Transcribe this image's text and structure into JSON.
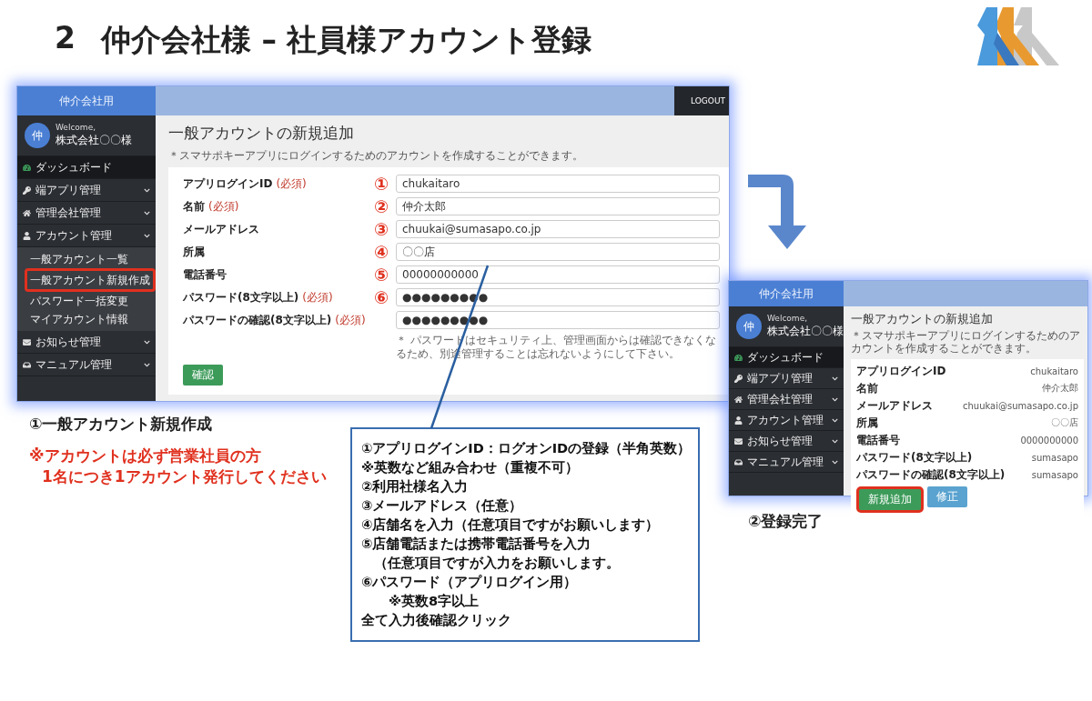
{
  "slide": {
    "number": "2",
    "title": "仲介会社様 – 社員様アカウント登録"
  },
  "screen_entry": {
    "brand": "仲介会社用",
    "logout": "LOGOUT",
    "user": {
      "avatar": "仲",
      "welcome": "Welcome,",
      "name": "株式会社〇〇様"
    },
    "menu": [
      {
        "label": "ダッシュボード",
        "kind": "link",
        "selected": true
      },
      {
        "label": "端アプリ管理",
        "kind": "group",
        "selected": false
      },
      {
        "label": "管理会社管理",
        "kind": "group",
        "selected": false
      },
      {
        "label": "アカウント管理",
        "kind": "group",
        "selected": false,
        "children": [
          {
            "label": "一般アカウント一覧",
            "highlighted": false
          },
          {
            "label": "一般アカウント新規作成",
            "highlighted": true
          },
          {
            "label": "パスワード一括変更",
            "highlighted": false
          },
          {
            "label": "マイアカウント情報",
            "highlighted": false
          }
        ]
      },
      {
        "label": "お知らせ管理",
        "kind": "group",
        "selected": false
      },
      {
        "label": "マニュアル管理",
        "kind": "group",
        "selected": false
      }
    ],
    "page_title": "一般アカウントの新規追加",
    "description": "＊スマサポキーアプリにログインするためのアカウントを作成することができます。",
    "fields": [
      {
        "label": "アプリログインID",
        "required_tag": "(必須)",
        "marker": "①",
        "value": "chukaitaro"
      },
      {
        "label": "名前",
        "required_tag": "(必須)",
        "marker": "②",
        "value": "仲介太郎"
      },
      {
        "label": "メールアドレス",
        "marker": "③",
        "value": "chuukai@sumasapo.co.jp"
      },
      {
        "label": "所属",
        "marker": "④",
        "value": "〇〇店"
      },
      {
        "label": "電話番号",
        "marker": "⑤",
        "value": "00000000000"
      },
      {
        "label": "パスワード(8文字以上)",
        "required_tag": "(必須)",
        "marker": "⑥",
        "value": "●●●●●●●●●"
      },
      {
        "label": "パスワードの確認(8文字以上)",
        "required_tag": "(必須)",
        "value": "●●●●●●●●●"
      }
    ],
    "note": "＊ パスワードはセキュリティ上、管理画面からは確認できなくなるため、別途管理することは忘れないようにして下さい。",
    "submit": "確認"
  },
  "screen_done": {
    "brand": "仲介会社用",
    "user": {
      "avatar": "仲",
      "welcome": "Welcome,",
      "name": "株式会社〇〇様"
    },
    "menu": [
      {
        "label": "ダッシュボード",
        "kind": "link",
        "selected": true
      },
      {
        "label": "端アプリ管理",
        "kind": "group",
        "selected": false
      },
      {
        "label": "管理会社管理",
        "kind": "group",
        "selected": false
      },
      {
        "label": "アカウント管理",
        "kind": "group",
        "selected": false
      },
      {
        "label": "お知らせ管理",
        "kind": "group",
        "selected": false
      },
      {
        "label": "マニュアル管理",
        "kind": "group",
        "selected": false
      }
    ],
    "page_title": "一般アカウントの新規追加",
    "description": "＊スマサポキーアプリにログインするためのアカウントを作成することができます。",
    "rows": [
      {
        "label": "アプリログインID",
        "value": "chukaitaro"
      },
      {
        "label": "名前",
        "value": "仲介太郎"
      },
      {
        "label": "メールアドレス",
        "value": "chuukai@sumasapo.co.jp"
      },
      {
        "label": "所属",
        "value": "〇〇店"
      },
      {
        "label": "電話番号",
        "value": "0000000000"
      },
      {
        "label": "パスワード(8文字以上)",
        "value": "sumasapo"
      },
      {
        "label": "パスワードの確認(8文字以上)",
        "value": "sumasapo"
      }
    ],
    "buttons": [
      {
        "label": "新規追加",
        "kind": "primary",
        "highlighted": true
      },
      {
        "label": "修正",
        "kind": "secondary",
        "highlighted": false
      }
    ]
  },
  "caption_entry": "①一般アカウント新規作成",
  "warning": [
    "※アカウントは必ず営業社員の方",
    "1名につき1アカウント発行してください"
  ],
  "caption_done": "②登録完了",
  "callout": [
    {
      "text": "①アプリログインID：ログオンIDの登録（半角英数）",
      "kind": "main"
    },
    {
      "text": "※英数など組み合わせ（重複不可）",
      "kind": "main"
    },
    {
      "text": "②利用社様名入力",
      "kind": "main"
    },
    {
      "text": "③メールアドレス（任意）",
      "kind": "main"
    },
    {
      "text": "④店舗名を入力（任意項目ですがお願いします）",
      "kind": "main"
    },
    {
      "text": "⑤店舗電話または携帯電話番号を入力",
      "kind": "main"
    },
    {
      "text": "（任意項目ですが入力をお願いします。",
      "kind": "cont"
    },
    {
      "text": "⑥パスワード（アプリログイン用）",
      "kind": "main"
    },
    {
      "text": "※英数8字以上",
      "kind": "sub"
    },
    {
      "text": "全て入力後確認クリック",
      "kind": "main"
    }
  ]
}
